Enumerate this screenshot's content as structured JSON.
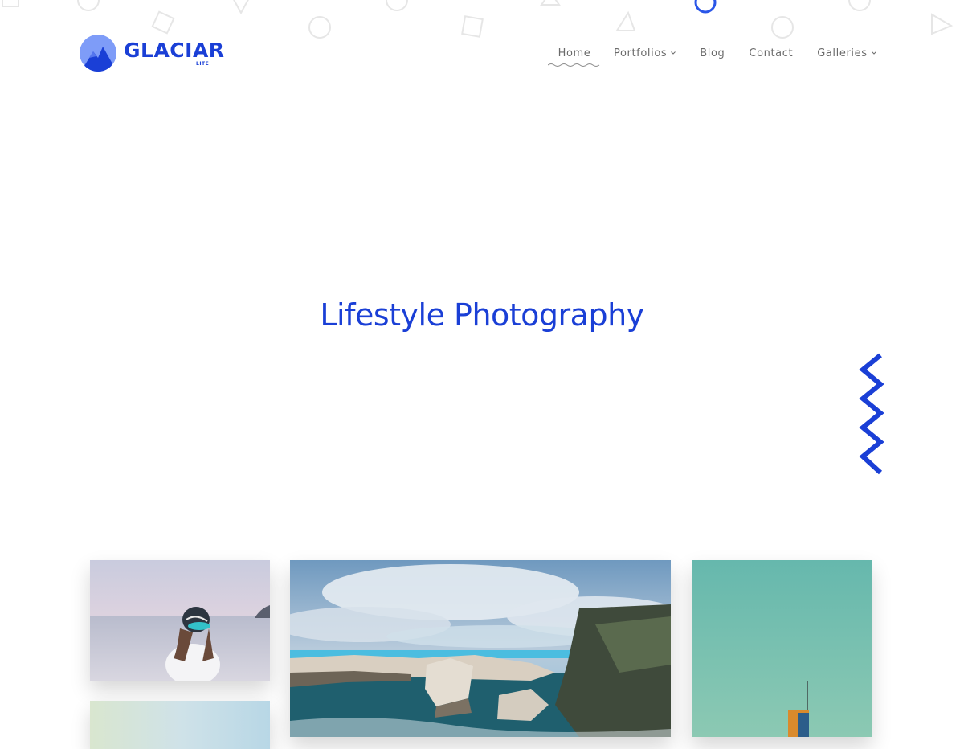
{
  "brand": {
    "name": "GLACIAR",
    "tagline": "LITE",
    "accent_color": "#1a3fd6"
  },
  "nav": {
    "items": [
      {
        "label": "Home",
        "active": true,
        "has_dropdown": false
      },
      {
        "label": "Portfolios",
        "active": false,
        "has_dropdown": true
      },
      {
        "label": "Blog",
        "active": false,
        "has_dropdown": false
      },
      {
        "label": "Contact",
        "active": false,
        "has_dropdown": false
      },
      {
        "label": "Galleries",
        "active": false,
        "has_dropdown": true
      }
    ]
  },
  "hero": {
    "title": "Lifestyle Photography"
  },
  "gallery": {
    "photos": [
      {
        "name": "girl-with-cap-by-sea"
      },
      {
        "name": "coastal-cliffs-landscape"
      },
      {
        "name": "tower-against-teal-sky"
      },
      {
        "name": "pale-blue-photo"
      }
    ]
  }
}
